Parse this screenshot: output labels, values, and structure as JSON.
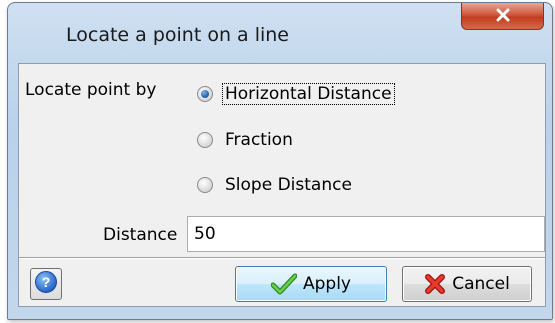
{
  "window": {
    "title": "Locate a point on a line",
    "close_icon": "close-x-icon"
  },
  "form": {
    "locate_by_label": "Locate point by",
    "options": [
      {
        "label": "Horizontal Distance",
        "checked": true
      },
      {
        "label": "Fraction",
        "checked": false
      },
      {
        "label": "Slope Distance",
        "checked": false
      }
    ],
    "distance_label": "Distance",
    "distance_value": "50"
  },
  "buttons": {
    "help_icon": "help-question-icon",
    "apply_label": "Apply",
    "apply_icon": "green-check-icon",
    "cancel_label": "Cancel",
    "cancel_icon": "red-x-icon"
  },
  "colors": {
    "accent": "#3c7fb1",
    "close_button": "#c13d20",
    "check_green": "#4caf3a",
    "cancel_red": "#d42020"
  }
}
